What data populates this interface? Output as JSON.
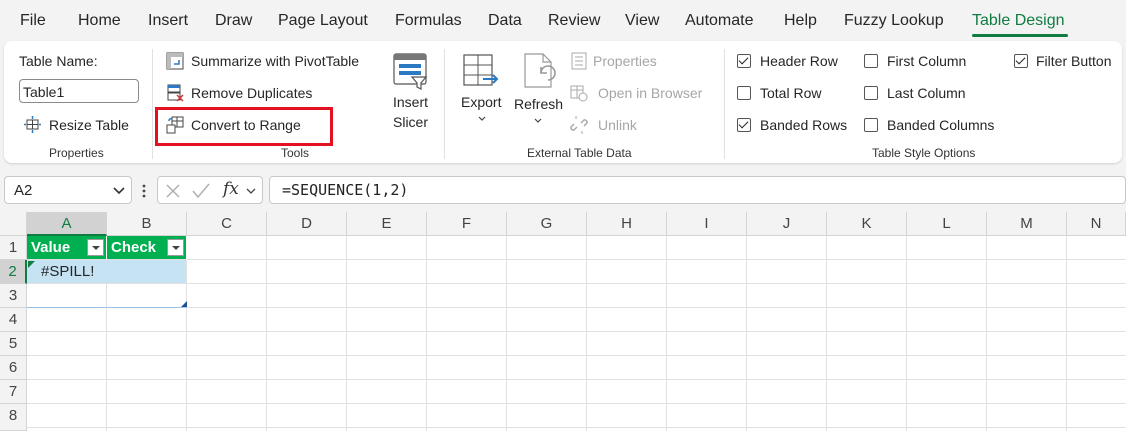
{
  "menu": {
    "items": [
      "File",
      "Home",
      "Insert",
      "Draw",
      "Page Layout",
      "Formulas",
      "Data",
      "Review",
      "View",
      "Automate",
      "Help",
      "Fuzzy Lookup",
      "Table Design"
    ],
    "active": "Table Design"
  },
  "ribbon": {
    "properties": {
      "table_name_label": "Table Name:",
      "table_name_value": "Table1",
      "resize_table": "Resize Table",
      "group_label": "Properties"
    },
    "tools": {
      "summarize": "Summarize with PivotTable",
      "remove_duplicates": "Remove Duplicates",
      "convert_to_range": "Convert to Range",
      "insert_slicer_line1": "Insert",
      "insert_slicer_line2": "Slicer",
      "group_label": "Tools"
    },
    "external": {
      "export": "Export",
      "refresh": "Refresh",
      "properties": "Properties",
      "open_in_browser": "Open in Browser",
      "unlink": "Unlink",
      "group_label": "External Table Data"
    },
    "style_options": {
      "header_row": {
        "label": "Header Row",
        "checked": true
      },
      "total_row": {
        "label": "Total Row",
        "checked": false
      },
      "banded_rows": {
        "label": "Banded Rows",
        "checked": true
      },
      "first_column": {
        "label": "First Column",
        "checked": false
      },
      "last_column": {
        "label": "Last Column",
        "checked": false
      },
      "banded_columns": {
        "label": "Banded Columns",
        "checked": false
      },
      "filter_button": {
        "label": "Filter Button",
        "checked": true
      },
      "group_label": "Table Style Options"
    }
  },
  "formula_bar": {
    "name_box": "A2",
    "fx": "fx",
    "formula": "=SEQUENCE(1,2)"
  },
  "grid": {
    "columns": [
      "A",
      "B",
      "C",
      "D",
      "E",
      "F",
      "G",
      "H",
      "I",
      "J",
      "K",
      "L",
      "M",
      "N"
    ],
    "rows": [
      "1",
      "2",
      "3",
      "4",
      "5",
      "6",
      "7",
      "8"
    ],
    "selected_column": "A",
    "selected_row": "2",
    "table": {
      "headers": [
        "Value",
        "Check"
      ],
      "cell_a2": "#SPILL!"
    }
  },
  "colors": {
    "accent": "#107c41",
    "table_header": "#00b050",
    "table_band": "#c5e3f3",
    "highlight": "#e3101f"
  }
}
